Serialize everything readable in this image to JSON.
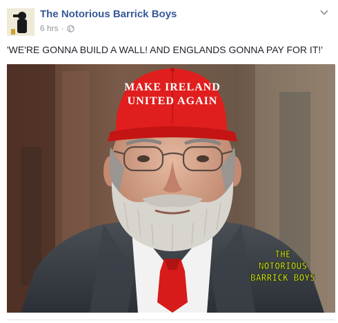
{
  "post": {
    "page_name": "The Notorious Barrick Boys",
    "timestamp": "6 hrs",
    "separator": "·",
    "privacy_icon": "globe-icon",
    "options_icon": "chevron-down-icon",
    "text": "'WE'RE GONNA BUILD A WALL! AND ENGLANDS GONNA PAY FOR IT!'"
  },
  "photo": {
    "cap_line1": "MAKE IRELAND",
    "cap_line2": "UNITED AGAIN",
    "watermark_line1": "THE",
    "watermark_line2": "NOTORIOUS",
    "watermark_line3": "BARRICK BOYS"
  },
  "colors": {
    "link": "#365899",
    "meta": "#90949c",
    "cap_red": "#e01e1e",
    "tie_red": "#d71a1a",
    "watermark": "#e6ef2a"
  }
}
